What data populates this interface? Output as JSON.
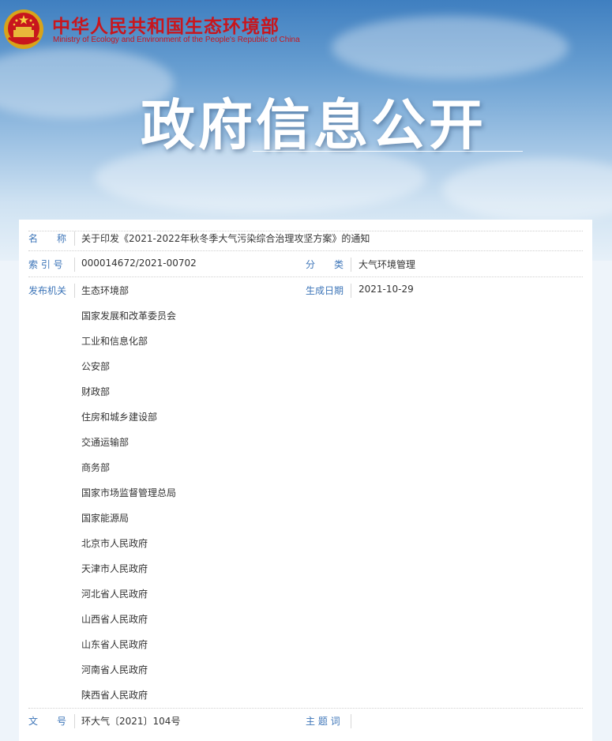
{
  "header": {
    "site_name_cn": "中华人民共和国生态环境部",
    "site_name_en": "Ministry of Ecology and Environment of the People's Republic of China",
    "banner_title": "政府信息公开"
  },
  "fields": {
    "name_label": "名　　称",
    "name_value": "关于印发《2021-2022年秋冬季大气污染综合治理攻坚方案》的通知",
    "index_label": "索 引 号",
    "index_value": "000014672/2021-00702",
    "category_label": "分　　类",
    "category_value": "大气环境管理",
    "issuer_label": "发布机关",
    "issuers": [
      "生态环境部",
      "国家发展和改革委员会",
      "工业和信息化部",
      "公安部",
      "财政部",
      "住房和城乡建设部",
      "交通运输部",
      "商务部",
      "国家市场监督管理总局",
      "国家能源局",
      "北京市人民政府",
      "天津市人民政府",
      "河北省人民政府",
      "山西省人民政府",
      "山东省人民政府",
      "河南省人民政府",
      "陕西省人民政府"
    ],
    "date_label": "生成日期",
    "date_value": "2021-10-29",
    "doc_no_label": "文　　号",
    "doc_no_value": "环大气〔2021〕104号",
    "keywords_label": "主 题 词",
    "keywords_value": ""
  },
  "colors": {
    "accent": "#c8161d",
    "label_blue": "#3d75b8"
  }
}
